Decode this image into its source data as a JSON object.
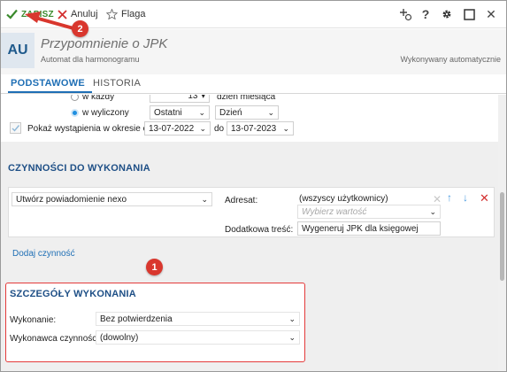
{
  "toolbar": {
    "save_label": "ZAPISZ",
    "cancel_label": "Anuluj",
    "flag_label": "Flaga",
    "right_icons": [
      "add-watch-icon",
      "help-icon",
      "gear-icon",
      "maximize-icon",
      "close-icon"
    ],
    "help_glyph": "?",
    "close_glyph": "✕"
  },
  "header": {
    "avatar": "AU",
    "title": "Przypomnienie o JPK",
    "subtitle": "Automat dla harmonogramu",
    "status": "Wykonywany automatycznie"
  },
  "tabs": [
    {
      "label": "PODSTAWOWE",
      "active": true
    },
    {
      "label": "HISTORIA",
      "active": false
    }
  ],
  "schedule": {
    "row_every_label": "w każdy",
    "row_every_value": "13",
    "row_every_suffix": "dzień miesiąca",
    "row_calc_label": "w wyliczony",
    "calc_option_1": "Ostatni",
    "calc_option_2": "Dzień",
    "show_label": "Pokaż wystąpienia w okresie od",
    "date_from": "13-07-2022",
    "date_to_label": "do",
    "date_to": "13-07-2023"
  },
  "tasks": {
    "title": "CZYNNOŚCI DO WYKONANIA",
    "action": "Utwórz powiadomienie nexo",
    "recipient_label": "Adresat:",
    "recipient_value": "(wszyscy użytkownicy)",
    "recipient_placeholder": "Wybierz wartość",
    "extra_label": "Dodatkowa treść:",
    "extra_value": "Wygeneruj JPK dla księgowej",
    "add_link": "Dodaj czynność"
  },
  "details": {
    "title": "SZCZEGÓŁY WYKONANIA",
    "execution_label": "Wykonanie:",
    "execution_value": "Bez potwierdzenia",
    "executor_label": "Wykonawca czynności:",
    "executor_value": "(dowolny)"
  },
  "callouts": {
    "one": "1",
    "two": "2"
  },
  "colors": {
    "accent": "#1f6fb5",
    "section_title": "#1e4f86",
    "save_green": "#3a8a2c",
    "callout_red": "#d9372e",
    "cancel_red": "#d32f2f"
  }
}
